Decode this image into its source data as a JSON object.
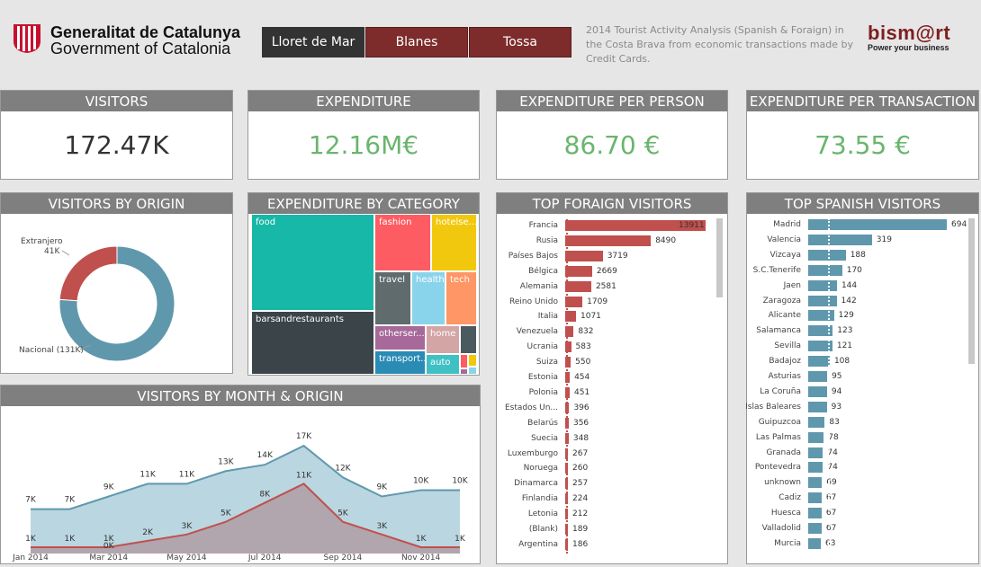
{
  "header": {
    "gov_line1": "Generalitat de Catalunya",
    "gov_line2": "Government of Catalonia",
    "tabs": [
      {
        "label": "Lloret de Mar",
        "active": true
      },
      {
        "label": "Blanes",
        "active": false
      },
      {
        "label": "Tossa",
        "active": false
      }
    ],
    "subtitle": "2014 Tourist Activity Analysis (Spanish & Foraign) in the Costa Brava from economic transactions made by Credit Cards.",
    "brand": "bism@rt",
    "brand_tagline": "Power your business"
  },
  "kpis": {
    "visitors": {
      "title": "VISITORS",
      "value": "172.47K"
    },
    "expenditure": {
      "title": "EXPENDITURE",
      "value": "12.16M€"
    },
    "per_person": {
      "title": "EXPENDITURE PER PERSON",
      "value": "86.70 €"
    },
    "per_transaction": {
      "title": "EXPENDITURE PER TRANSACTION",
      "value": "73.55 €"
    }
  },
  "colors": {
    "red": "#c0504d",
    "blue": "#5f98ad",
    "green": "#6ab56d",
    "header_gray": "#7f7f7f"
  },
  "origin": {
    "title": "VISITORS BY ORIGIN",
    "extranjero_label": "Extranjero",
    "extranjero_value": "41K",
    "nacional_label": "Nacional (131K)",
    "extranjero": 41,
    "nacional": 131
  },
  "category": {
    "title": "EXPENDITURE BY CATEGORY",
    "labels": {
      "food": "food",
      "bars": "barsandrestaurants",
      "fashion": "fashion",
      "hotels": "hotelse...",
      "travel": "travel",
      "health": "health",
      "tech": "tech",
      "other": "otherser...",
      "home": "home",
      "transport": "transport...",
      "auto": "auto"
    }
  },
  "monthly": {
    "title": "VISITORS BY MONTH & ORIGIN",
    "x_labels": [
      "Jan 2014",
      "Mar 2014",
      "May 2014",
      "Jul 2014",
      "Sep 2014",
      "Nov 2014"
    ],
    "total": [
      7,
      7,
      9,
      11,
      11,
      13,
      14,
      17,
      12,
      9,
      10,
      10
    ],
    "foreign": [
      1,
      1,
      1,
      2,
      3,
      5,
      8,
      11,
      5,
      3,
      1,
      1
    ],
    "total_labels": [
      "7K",
      "7K",
      "9K",
      "11K",
      "11K",
      "13K",
      "14K",
      "17K",
      "12K",
      "9K",
      "10K",
      "10K"
    ],
    "foreign_labels": [
      "1K",
      "1K",
      "1K",
      "2K",
      "3K",
      "5K",
      "8K",
      "11K",
      "5K",
      "3K",
      "1K",
      "1K"
    ],
    "extra_label": "0K"
  },
  "foreign": {
    "title": "TOP FORAIGN VISITORS",
    "items": [
      {
        "name": "Francia",
        "value": 13911
      },
      {
        "name": "Rusia",
        "value": 8490
      },
      {
        "name": "Países Bajos",
        "value": 3719
      },
      {
        "name": "Bélgica",
        "value": 2669
      },
      {
        "name": "Alemania",
        "value": 2581
      },
      {
        "name": "Reino Unido",
        "value": 1709
      },
      {
        "name": "Italia",
        "value": 1071
      },
      {
        "name": "Venezuela",
        "value": 832
      },
      {
        "name": "Ucrania",
        "value": 583
      },
      {
        "name": "Suiza",
        "value": 550
      },
      {
        "name": "Estonia",
        "value": 454
      },
      {
        "name": "Polonia",
        "value": 451
      },
      {
        "name": "Estados Un...",
        "value": 396
      },
      {
        "name": "Belarús",
        "value": 356
      },
      {
        "name": "Suecia",
        "value": 348
      },
      {
        "name": "Luxemburgo",
        "value": 267
      },
      {
        "name": "Noruega",
        "value": 260
      },
      {
        "name": "Dinamarca",
        "value": 257
      },
      {
        "name": "Finlandia",
        "value": 224
      },
      {
        "name": "Letonia",
        "value": 212
      },
      {
        "name": "(Blank)",
        "value": 189
      },
      {
        "name": "Argentina",
        "value": 186
      }
    ]
  },
  "spanish": {
    "title": "TOP SPANISH VISITORS",
    "items": [
      {
        "name": "Madrid",
        "value": 694
      },
      {
        "name": "Valencia",
        "value": 319
      },
      {
        "name": "Vizcaya",
        "value": 188
      },
      {
        "name": "S.C.Tenerife",
        "value": 170
      },
      {
        "name": "Jaen",
        "value": 144
      },
      {
        "name": "Zaragoza",
        "value": 142
      },
      {
        "name": "Alicante",
        "value": 129
      },
      {
        "name": "Salamanca",
        "value": 123
      },
      {
        "name": "Sevilla",
        "value": 121
      },
      {
        "name": "Badajoz",
        "value": 108
      },
      {
        "name": "Asturias",
        "value": 95
      },
      {
        "name": "La Coruña",
        "value": 94
      },
      {
        "name": "Islas Baleares",
        "value": 93
      },
      {
        "name": "Guipuzcoa",
        "value": 83
      },
      {
        "name": "Las Palmas",
        "value": 78
      },
      {
        "name": "Granada",
        "value": 74
      },
      {
        "name": "Pontevedra",
        "value": 74
      },
      {
        "name": "unknown",
        "value": 69
      },
      {
        "name": "Cadiz",
        "value": 67
      },
      {
        "name": "Huesca",
        "value": 67
      },
      {
        "name": "Valladolid",
        "value": 67
      },
      {
        "name": "Murcia",
        "value": 63
      }
    ]
  }
}
